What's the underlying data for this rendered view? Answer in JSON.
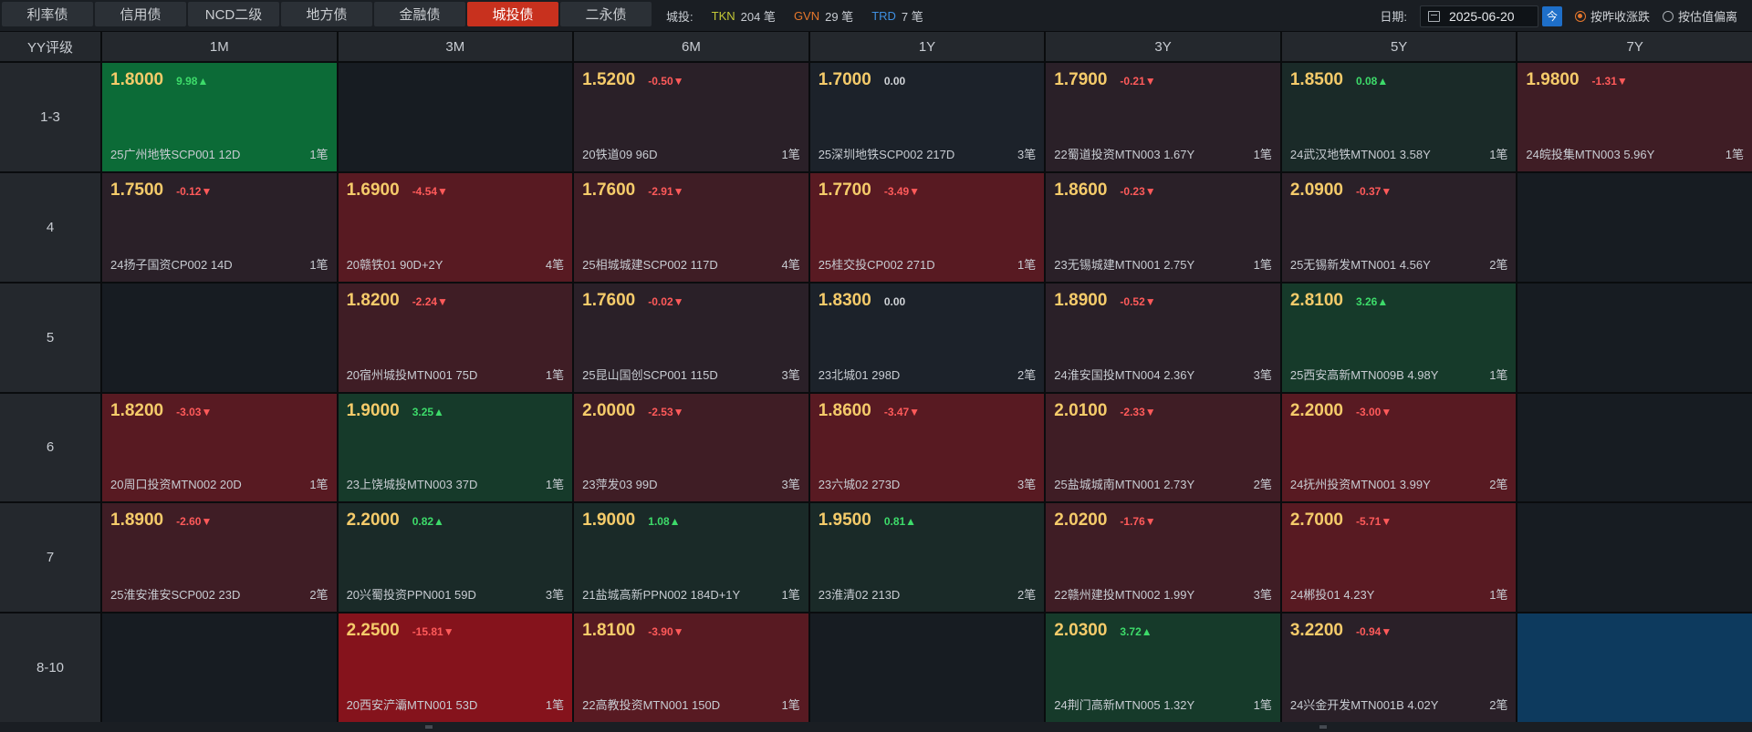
{
  "tabs": [
    "利率债",
    "信用债",
    "NCD二级",
    "地方债",
    "金融债",
    "城投债",
    "二永债"
  ],
  "active_tab_index": 5,
  "citytou": {
    "label": "城投:",
    "tkn_label": "TKN",
    "tkn_count": "204 笔",
    "gvn_label": "GVN",
    "gvn_count": "29 笔",
    "trd_label": "TRD",
    "trd_count": "7 笔"
  },
  "date": {
    "label": "日期:",
    "value": "2025-06-20",
    "today": "今"
  },
  "radios": [
    {
      "label": "按昨收涨跌",
      "selected": true
    },
    {
      "label": "按估值偏离",
      "selected": false
    }
  ],
  "grid": {
    "corner": "YY评级",
    "columns": [
      "1M",
      "3M",
      "6M",
      "1Y",
      "3Y",
      "5Y",
      "7Y"
    ],
    "rows": [
      {
        "rating": "1-3",
        "cells": [
          {
            "bg": "g3",
            "yield": "1.8000",
            "chg": "9.98▲",
            "dir": "up",
            "bond": "25广州地铁SCP001 12D",
            "cnt": "1笔"
          },
          {
            "bg": "empty"
          },
          {
            "bg": "r1",
            "yield": "1.5200",
            "chg": "-0.50▼",
            "dir": "down",
            "bond": "20铁道09 96D",
            "cnt": "1笔"
          },
          {
            "bg": "n",
            "yield": "1.7000",
            "chg": "0.00",
            "dir": "flat",
            "bond": "25深圳地铁SCP002 217D",
            "cnt": "3笔"
          },
          {
            "bg": "r1",
            "yield": "1.7900",
            "chg": "-0.21▼",
            "dir": "down",
            "bond": "22蜀道投资MTN003 1.67Y",
            "cnt": "1笔"
          },
          {
            "bg": "g1",
            "yield": "1.8500",
            "chg": "0.08▲",
            "dir": "up",
            "bond": "24武汉地铁MTN001 3.58Y",
            "cnt": "1笔"
          },
          {
            "bg": "r2",
            "yield": "1.9800",
            "chg": "-1.31▼",
            "dir": "down",
            "bond": "24皖投集MTN003 5.96Y",
            "cnt": "1笔"
          }
        ]
      },
      {
        "rating": "4",
        "cells": [
          {
            "bg": "r1",
            "yield": "1.7500",
            "chg": "-0.12▼",
            "dir": "down",
            "bond": "24扬子国资CP002 14D",
            "cnt": "1笔"
          },
          {
            "bg": "r3",
            "yield": "1.6900",
            "chg": "-4.54▼",
            "dir": "down",
            "bond": "20赣铁01 90D+2Y",
            "cnt": "4笔"
          },
          {
            "bg": "r2",
            "yield": "1.7600",
            "chg": "-2.91▼",
            "dir": "down",
            "bond": "25相城城建SCP002 117D",
            "cnt": "4笔"
          },
          {
            "bg": "r3",
            "yield": "1.7700",
            "chg": "-3.49▼",
            "dir": "down",
            "bond": "25桂交投CP002 271D",
            "cnt": "1笔"
          },
          {
            "bg": "r1",
            "yield": "1.8600",
            "chg": "-0.23▼",
            "dir": "down",
            "bond": "23无锡城建MTN001 2.75Y",
            "cnt": "1笔"
          },
          {
            "bg": "r1",
            "yield": "2.0900",
            "chg": "-0.37▼",
            "dir": "down",
            "bond": "25无锡新发MTN001 4.56Y",
            "cnt": "2笔"
          },
          {
            "bg": "empty"
          }
        ]
      },
      {
        "rating": "5",
        "cells": [
          {
            "bg": "empty"
          },
          {
            "bg": "r2",
            "yield": "1.8200",
            "chg": "-2.24▼",
            "dir": "down",
            "bond": "20宿州城投MTN001 75D",
            "cnt": "1笔"
          },
          {
            "bg": "r1",
            "yield": "1.7600",
            "chg": "-0.02▼",
            "dir": "down",
            "bond": "25昆山国创SCP001 115D",
            "cnt": "3笔"
          },
          {
            "bg": "n",
            "yield": "1.8300",
            "chg": "0.00",
            "dir": "flat",
            "bond": "23北城01 298D",
            "cnt": "2笔"
          },
          {
            "bg": "r1",
            "yield": "1.8900",
            "chg": "-0.52▼",
            "dir": "down",
            "bond": "24淮安国投MTN004 2.36Y",
            "cnt": "3笔"
          },
          {
            "bg": "g2",
            "yield": "2.8100",
            "chg": "3.26▲",
            "dir": "up",
            "bond": "25西安高新MTN009B 4.98Y",
            "cnt": "1笔"
          },
          {
            "bg": "empty"
          }
        ]
      },
      {
        "rating": "6",
        "cells": [
          {
            "bg": "r3",
            "yield": "1.8200",
            "chg": "-3.03▼",
            "dir": "down",
            "bond": "20周口投资MTN002 20D",
            "cnt": "1笔"
          },
          {
            "bg": "g2",
            "yield": "1.9000",
            "chg": "3.25▲",
            "dir": "up",
            "bond": "23上饶城投MTN003 37D",
            "cnt": "1笔"
          },
          {
            "bg": "r2",
            "yield": "2.0000",
            "chg": "-2.53▼",
            "dir": "down",
            "bond": "23萍发03 99D",
            "cnt": "3笔"
          },
          {
            "bg": "r3",
            "yield": "1.8600",
            "chg": "-3.47▼",
            "dir": "down",
            "bond": "23六城02 273D",
            "cnt": "3笔"
          },
          {
            "bg": "r2",
            "yield": "2.0100",
            "chg": "-2.33▼",
            "dir": "down",
            "bond": "25盐城城南MTN001 2.73Y",
            "cnt": "2笔"
          },
          {
            "bg": "r3",
            "yield": "2.2000",
            "chg": "-3.00▼",
            "dir": "down",
            "bond": "24抚州投资MTN001 3.99Y",
            "cnt": "2笔"
          },
          {
            "bg": "empty"
          }
        ]
      },
      {
        "rating": "7",
        "cells": [
          {
            "bg": "r2",
            "yield": "1.8900",
            "chg": "-2.60▼",
            "dir": "down",
            "bond": "25淮安淮安SCP002 23D",
            "cnt": "2笔"
          },
          {
            "bg": "g1",
            "yield": "2.2000",
            "chg": "0.82▲",
            "dir": "up",
            "bond": "20兴蜀投资PPN001 59D",
            "cnt": "3笔"
          },
          {
            "bg": "g1",
            "yield": "1.9000",
            "chg": "1.08▲",
            "dir": "up",
            "bond": "21盐城高新PPN002 184D+1Y",
            "cnt": "1笔"
          },
          {
            "bg": "g1",
            "yield": "1.9500",
            "chg": "0.81▲",
            "dir": "up",
            "bond": "23淮清02 213D",
            "cnt": "2笔"
          },
          {
            "bg": "r2",
            "yield": "2.0200",
            "chg": "-1.76▼",
            "dir": "down",
            "bond": "22赣州建投MTN002 1.99Y",
            "cnt": "3笔"
          },
          {
            "bg": "r3",
            "yield": "2.7000",
            "chg": "-5.71▼",
            "dir": "down",
            "bond": "24郴投01 4.23Y",
            "cnt": "1笔"
          },
          {
            "bg": "empty"
          }
        ]
      },
      {
        "rating": "8-10",
        "cells": [
          {
            "bg": "empty"
          },
          {
            "bg": "r4",
            "yield": "2.2500",
            "chg": "-15.81▼",
            "dir": "down",
            "bond": "20西安浐灞MTN001 53D",
            "cnt": "1笔"
          },
          {
            "bg": "r3",
            "yield": "1.8100",
            "chg": "-3.90▼",
            "dir": "down",
            "bond": "22高教投资MTN001 150D",
            "cnt": "1笔"
          },
          {
            "bg": "empty"
          },
          {
            "bg": "g2",
            "yield": "2.0300",
            "chg": "3.72▲",
            "dir": "up",
            "bond": "24荆门高新MTN005 1.32Y",
            "cnt": "1笔"
          },
          {
            "bg": "r1",
            "yield": "3.2200",
            "chg": "-0.94▼",
            "dir": "down",
            "bond": "24兴金开发MTN001B 4.02Y",
            "cnt": "2笔"
          },
          {
            "bg": "blue"
          }
        ]
      }
    ]
  }
}
